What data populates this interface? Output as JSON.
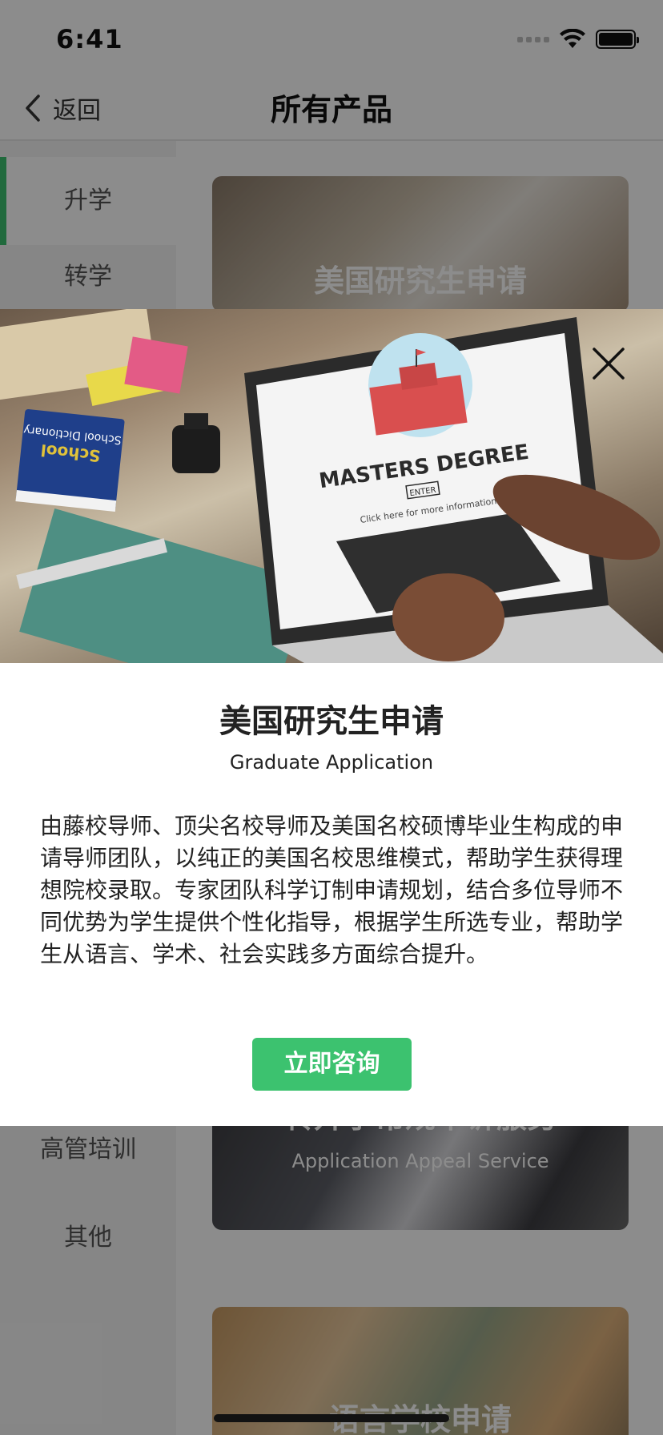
{
  "status_bar": {
    "time": "6:41"
  },
  "nav": {
    "back_label": "返回",
    "title": "所有产品"
  },
  "sidebar": {
    "items": [
      {
        "label": "升学"
      },
      {
        "label": "转学"
      },
      {
        "label": "高管培训"
      },
      {
        "label": "其他"
      }
    ],
    "active_index": 0
  },
  "cards": [
    {
      "title": "美国研究生申请",
      "subtitle": ""
    },
    {
      "title": "转升学常规申诉服务",
      "subtitle": "Application Appeal Service"
    },
    {
      "title": "语言学校申请",
      "subtitle": ""
    }
  ],
  "modal": {
    "image_alt": "MASTERS DEGREE",
    "image_enter": "ENTER",
    "image_caption": "Click here for more information",
    "book_title": "School Dictionary",
    "title": "美国研究生申请",
    "subtitle": "Graduate Application",
    "description": "由藤校导师、顶尖名校导师及美国名校硕博毕业生构成的申请导师团队，以纯正的美国名校思维模式，帮助学生获得理想院校录取。专家团队科学订制申请规划，结合多位导师不同优势为学生提供个性化指导，根据学生所选专业，帮助学生从语言、学术、社会实践多方面综合提升。",
    "button_label": "立即咨询"
  },
  "colors": {
    "accent": "#3cc26f",
    "mask": "rgba(0,0,0,0.45)"
  }
}
